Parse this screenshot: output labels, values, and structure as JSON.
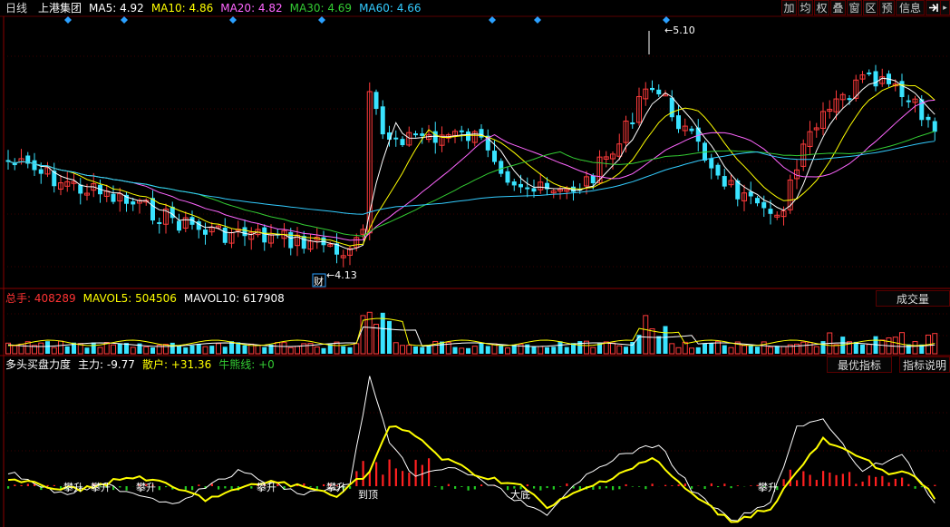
{
  "header": {
    "period": "日线",
    "stock_name": "上港集团",
    "ma": [
      {
        "label": "MA5: 4.92",
        "color": "#ffffff"
      },
      {
        "label": "MA10: 4.86",
        "color": "#ffff00"
      },
      {
        "label": "MA20: 4.82",
        "color": "#ff66ff"
      },
      {
        "label": "MA30: 4.69",
        "color": "#33cc33"
      },
      {
        "label": "MA60: 4.66",
        "color": "#33ccff"
      }
    ],
    "buttons": [
      "加",
      "均",
      "权",
      "叠",
      "窗",
      "区",
      "预",
      "信息"
    ],
    "arrow_icon": "enter-arrow-icon",
    "more_icon": "more-icon"
  },
  "price_panel": {
    "high_label": "5.10",
    "low_label": "4.13",
    "finance_marker": "财"
  },
  "volume_panel": {
    "title": "总手: 408289",
    "mavol5": "MAVOL5: 504506",
    "mavol10": "MAVOL10: 617908",
    "switch_label": "成交量",
    "colors": {
      "title": "#ff3333",
      "mavol5": "#ffff00",
      "mavol10": "#ffffff"
    }
  },
  "indicator_panel": {
    "name": "多头买盘力度",
    "main_force": "主力: -9.77",
    "retail": "散户: +31.36",
    "bull_line": "牛熊线: +0",
    "best_button": "最优指标",
    "help_button": "指标说明",
    "signal_labels": [
      {
        "text": "攀升"
      },
      {
        "text": "攀升"
      },
      {
        "text": "攀升"
      },
      {
        "text": "攀升"
      },
      {
        "text": "攀升"
      },
      {
        "text": "到顶"
      },
      {
        "text": "大底"
      },
      {
        "text": "攀升"
      }
    ],
    "colors": {
      "name": "#ffffff",
      "main_force": "#ffffff",
      "retail": "#ffff00",
      "bull_line": "#33cc33"
    }
  }
}
